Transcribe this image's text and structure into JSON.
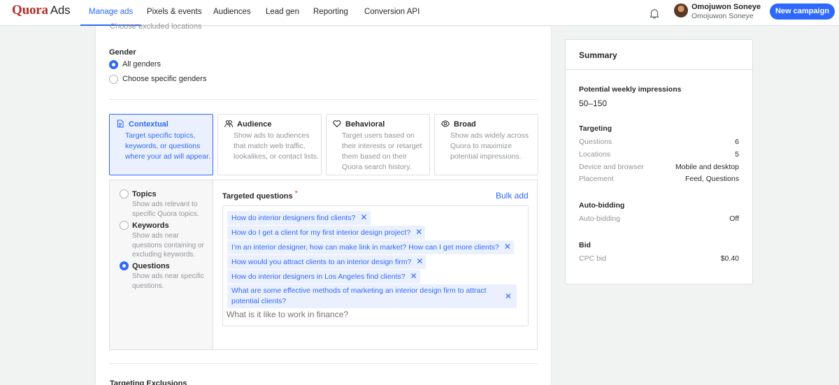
{
  "brand": {
    "logo_main": "Quora",
    "logo_suffix": "Ads"
  },
  "nav": {
    "tabs": [
      {
        "label": "Manage ads",
        "active": true
      },
      {
        "label": "Pixels & events"
      },
      {
        "label": "Audiences"
      },
      {
        "label": "Lead gen"
      },
      {
        "label": "Reporting"
      },
      {
        "label": "Conversion API"
      }
    ],
    "user_name": "Omojuwon Soneye",
    "user_account": "Omojuwon Soneye",
    "new_campaign": "New campaign"
  },
  "main": {
    "cut_top_text": "Choose excluded locations",
    "gender": {
      "label": "Gender",
      "options": [
        {
          "label": "All genders",
          "selected": true
        },
        {
          "label": "Choose specific genders",
          "selected": false
        }
      ]
    },
    "targeting_cards": [
      {
        "icon": "document-icon",
        "title": "Contextual",
        "desc": "Target specific topics, keywords, or questions where your ad will appear.",
        "active": true
      },
      {
        "icon": "people-icon",
        "title": "Audience",
        "desc": "Show ads to audiences that match web traffic, lookalikes, or contact lists."
      },
      {
        "icon": "heart-icon",
        "title": "Behavioral",
        "desc": "Target users based on their interests or retarget them based on their Quora search history."
      },
      {
        "icon": "eye-icon",
        "title": "Broad",
        "desc": "Show ads widely across Quora to maximize potential impressions."
      }
    ],
    "contextual_options": [
      {
        "title": "Topics",
        "desc": "Show ads relevant to specific Quora topics.",
        "selected": false
      },
      {
        "title": "Keywords",
        "desc": "Show ads near questions containing or excluding keywords.",
        "selected": false
      },
      {
        "title": "Questions",
        "desc": "Show ads near specific questions.",
        "selected": true
      }
    ],
    "targeted_questions": {
      "label": "Targeted questions",
      "required_mark": "*",
      "bulk_add": "Bulk add",
      "questions": [
        "How do interior designers find clients?",
        "How do I get a client for my first interior design project?",
        "I’m an interior designer, how can make link in market? How can I get more clients?",
        "How would you attract clients to an interior design firm?",
        "How do interior designers in Los Angeles find clients?",
        "What are some effective methods of marketing an interior design firm to attract potential clients?"
      ],
      "placeholder": "What is it like to work in finance?"
    },
    "cut_bottom_text": "Targeting Exclusions"
  },
  "summary": {
    "title": "Summary",
    "impressions_label": "Potential weekly impressions",
    "impressions_value": "50–150",
    "targeting_label": "Targeting",
    "targeting": [
      {
        "key": "Questions",
        "value": "6"
      },
      {
        "key": "Locations",
        "value": "5"
      },
      {
        "key": "Device and browser",
        "value": "Mobile and desktop"
      },
      {
        "key": "Placement",
        "value": "Feed, Questions"
      }
    ],
    "auto_bidding_label": "Auto-bidding",
    "auto_bidding_key": "Auto-bidding",
    "auto_bidding_value": "Off",
    "bid_label": "Bid",
    "bid_key": "CPC bid",
    "bid_value": "$0.40"
  },
  "colors": {
    "accent": "#2e69ff",
    "brand": "#b92b27"
  }
}
